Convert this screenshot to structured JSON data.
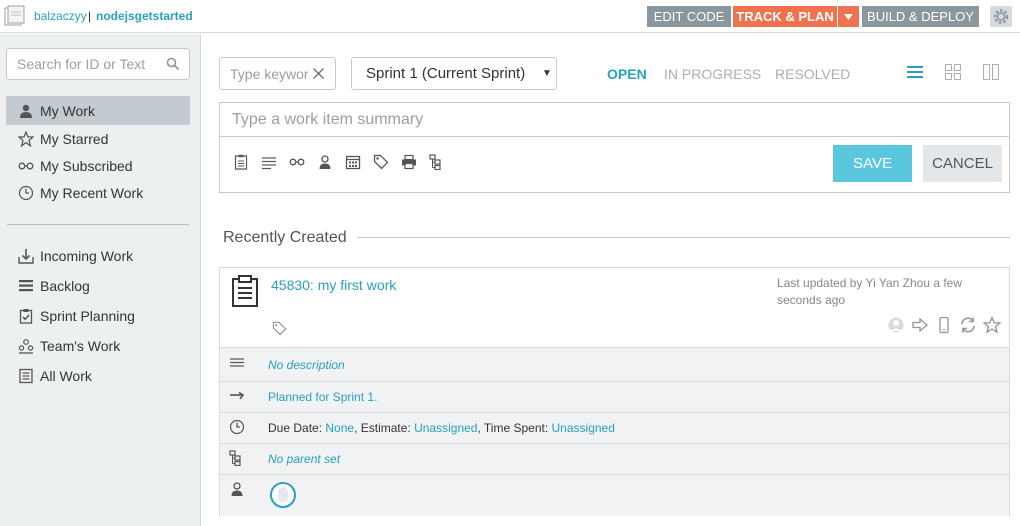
{
  "header": {
    "user": "balzaczyy",
    "separator": "|",
    "project": "nodejsgetstarted",
    "nav": {
      "edit_code": "EDIT CODE",
      "track_plan": "TRACK & PLAN",
      "build_deploy": "BUILD & DEPLOY"
    },
    "active_nav": "track_plan",
    "colors": {
      "active": "#f0724f",
      "inactive": "#8c969e",
      "accent": "#2a9fc0"
    }
  },
  "sidebar": {
    "search_placeholder": "Search for ID or Text",
    "views": [
      {
        "label": "My Work",
        "icon": "person-icon",
        "active": true
      },
      {
        "label": "My Starred",
        "icon": "star-icon"
      },
      {
        "label": "My Subscribed",
        "icon": "glasses-icon"
      },
      {
        "label": "My Recent Work",
        "icon": "clock-icon"
      }
    ],
    "sections": [
      {
        "label": "Incoming Work",
        "icon": "inbox-icon"
      },
      {
        "label": "Backlog",
        "icon": "backlog-icon"
      },
      {
        "label": "Sprint Planning",
        "icon": "sprint-icon"
      },
      {
        "label": "Team's Work",
        "icon": "team-icon"
      },
      {
        "label": "All Work",
        "icon": "list-icon"
      }
    ]
  },
  "filter": {
    "keyword_placeholder": "Type keywords",
    "sprint_selected": "Sprint 1 (Current Sprint)",
    "states": {
      "open": "OPEN",
      "in_progress": "IN PROGRESS",
      "resolved": "RESOLVED"
    },
    "active_state": "open"
  },
  "quick_add": {
    "summary_placeholder": "Type a work item summary",
    "save_label": "SAVE",
    "cancel_label": "CANCEL"
  },
  "recent": {
    "heading": "Recently Created",
    "item": {
      "title": "45830: my first work",
      "updated": "Last updated by Yi Yan Zhou a few seconds ago",
      "description": "No description",
      "planned": "Planned for Sprint 1.",
      "due_label": "Due Date: ",
      "due_value": "None",
      "estimate_label": ", Estimate: ",
      "estimate_value": "Unassigned",
      "time_label": ", Time Spent: ",
      "time_value": "Unassigned",
      "parent": "No parent set"
    }
  }
}
